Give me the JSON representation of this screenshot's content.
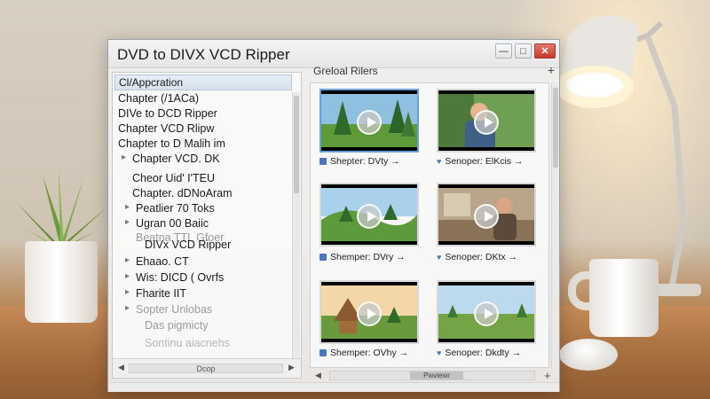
{
  "window": {
    "title": "DVD to DIVX VCD Ripper"
  },
  "left_panel": {
    "header": "Cl/Appcration",
    "items": [
      {
        "label": "Chapter (/1ACa)"
      },
      {
        "label": "DIVe to DCD Ripper"
      },
      {
        "label": "Chapter VCD Rlipw"
      },
      {
        "label": "Chapter to D Malih im"
      },
      {
        "label": "Chapter VCD. DK"
      },
      {
        "label": "Cheor Uid' I'TEU"
      },
      {
        "label": "Chapter. dDNoAram"
      },
      {
        "label": "Peatlier 70 Toks"
      },
      {
        "label": "Ugran 00 Baiic"
      },
      {
        "label": "Beatna TTL Gfoer"
      },
      {
        "label": "DIVx VCD Ripper"
      },
      {
        "label": "Ehaao. CT"
      },
      {
        "label": "Wis: DICD ( Ovrfs"
      },
      {
        "label": "Fharite IIT"
      },
      {
        "label": "Sopter Unlobas"
      },
      {
        "label": "Das pigmicty"
      },
      {
        "label": "Sontinu aiacnehs"
      }
    ],
    "scroll_label": "Dcop"
  },
  "right_panel": {
    "title": "Greloal Rilers",
    "plus": "+",
    "thumbnails": [
      {
        "caption": "Shepter: DVty →",
        "scene": "forest"
      },
      {
        "caption": "Senoper: ElKcis →",
        "scene": "person"
      },
      {
        "caption": "Shemper: DVry →",
        "scene": "valley"
      },
      {
        "caption": "Senoper: DKtx →",
        "scene": "office"
      },
      {
        "caption": "Shemper: OVhy →",
        "scene": "hut"
      },
      {
        "caption": "Senoper: Dkdty →",
        "scene": "field"
      }
    ],
    "preview_label": "Pwviewr",
    "bottom_plus": "+"
  },
  "icons": {
    "minimize": "minimize-icon",
    "maximize": "maximize-icon",
    "close": "close-icon"
  },
  "colors": {
    "selection": "#6aa0d6",
    "caption_icon": "#4a78b8",
    "close_button": "#c7392b"
  }
}
